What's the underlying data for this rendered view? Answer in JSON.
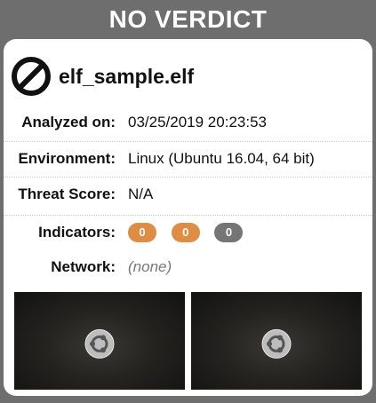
{
  "banner": {
    "title": "NO VERDICT"
  },
  "card": {
    "file_name": "elf_sample.elf",
    "status_icon": "no-verdict-circle-slash-icon",
    "rows": {
      "analyzed_label": "Analyzed on:",
      "analyzed_value": "03/25/2019 20:23:53",
      "environment_label": "Environment:",
      "environment_value": "Linux (Ubuntu 16.04, 64 bit)",
      "threat_label": "Threat Score:",
      "threat_value": "N/A",
      "indicators_label": "Indicators:",
      "indicators": [
        "0",
        "0",
        "0"
      ],
      "network_label": "Network:",
      "network_value": "(none)"
    },
    "screenshots": [
      {
        "icon": "ubuntu-logo-icon"
      },
      {
        "icon": "ubuntu-logo-icon"
      }
    ]
  },
  "colors": {
    "banner_bg": "#6e6e6e",
    "indicator_malicious": "#df8c44",
    "indicator_suspicious": "#df8c44",
    "indicator_informative": "#757575"
  }
}
